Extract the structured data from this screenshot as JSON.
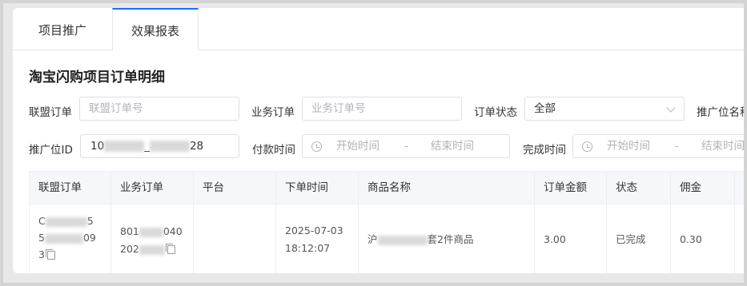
{
  "tabs": [
    {
      "label": "项目推广"
    },
    {
      "label": "效果报表"
    }
  ],
  "title": "淘宝闪购项目订单明细",
  "filters": {
    "union_order": {
      "label": "联盟订单",
      "placeholder": "联盟订单号"
    },
    "biz_order": {
      "label": "业务订单",
      "placeholder": "业务订单号"
    },
    "order_status": {
      "label": "订单状态",
      "value": "全部"
    },
    "promo_position_name": {
      "label": "推广位名称"
    },
    "promo_position_id": {
      "label": "推广位ID",
      "value_prefix": "10",
      "value_mid": "_",
      "value_suffix": "28"
    },
    "pay_time": {
      "label": "付款时间",
      "start": "开始时间",
      "sep": "-",
      "end": "结束时间"
    },
    "finish_time": {
      "label": "完成时间",
      "start": "开始时间",
      "sep": "-",
      "end": "结束时间"
    }
  },
  "table": {
    "columns": [
      "联盟订单",
      "业务订单",
      "平台",
      "下单时间",
      "商品名称",
      "订单金额",
      "状态",
      "佣金"
    ],
    "rows": [
      {
        "union_order": {
          "line1_prefix": "C",
          "line1_suffix": "5",
          "line2_prefix": "5",
          "line2_suffix": "09",
          "line3": "3"
        },
        "biz_order": {
          "line1_prefix": "801",
          "line1_suffix": "040",
          "line2_prefix": "202"
        },
        "platform": "",
        "order_date": "2025-07-03",
        "order_time": "18:12:07",
        "product": {
          "prefix": "沪",
          "suffix": "套2件商品"
        },
        "amount": "3.00",
        "status": "已完成",
        "commission": "0.30"
      }
    ]
  }
}
